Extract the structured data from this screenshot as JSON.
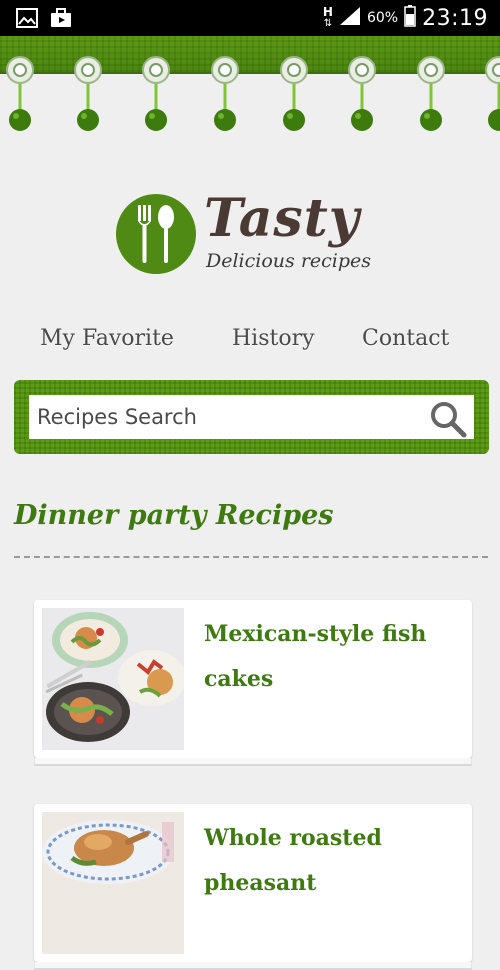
{
  "status_bar": {
    "network": "H",
    "battery": "60%",
    "time": "23:19",
    "icons": [
      "gallery-icon",
      "briefcase-icon",
      "network-h-icon",
      "signal-icon",
      "battery-icon"
    ]
  },
  "logo": {
    "title": "Tasty",
    "subtitle": "Delicious recipes",
    "icon": "fork-spoon-icon"
  },
  "nav": {
    "items": [
      {
        "label": "My Favorite"
      },
      {
        "label": "History"
      },
      {
        "label": "Contact"
      }
    ]
  },
  "search": {
    "placeholder": "Recipes Search",
    "icon": "search-icon"
  },
  "section": {
    "title": "Dinner party Recipes"
  },
  "recipes": [
    {
      "title": "Mexican-style fish cakes"
    },
    {
      "title": "Whole roasted pheasant"
    }
  ],
  "colors": {
    "accent": "#5a9d15",
    "title_green": "#3e7a10",
    "status_bar": "#000000",
    "background": "#efefef"
  }
}
